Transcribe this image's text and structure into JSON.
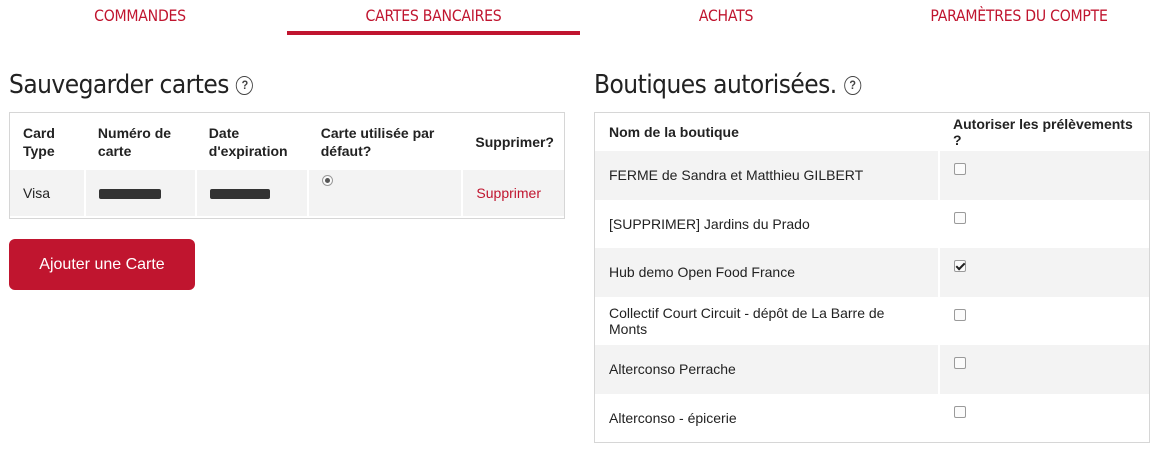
{
  "tabs": [
    {
      "label": "COMMANDES",
      "active": false
    },
    {
      "label": "CARTES BANCAIRES",
      "active": true
    },
    {
      "label": "ACHATS",
      "active": false
    },
    {
      "label": "PARAMÈTRES DU COMPTE",
      "active": false
    }
  ],
  "accent_color": "#c0152f",
  "saved_cards": {
    "title": "Sauvegarder cartes",
    "help_icon": "?",
    "headers": {
      "card_type": "Card Type",
      "card_number": "Numéro de carte",
      "expiry": "Date d'expiration",
      "default": "Carte utilisée par défaut?",
      "delete": "Supprimer?"
    },
    "rows": [
      {
        "type": "Visa",
        "number_masked": true,
        "expiry_masked": true,
        "is_default": true,
        "delete_label": "Supprimer"
      }
    ],
    "add_button": "Ajouter une Carte"
  },
  "shops": {
    "title": "Boutiques autorisées.",
    "help_icon": "?",
    "headers": {
      "name": "Nom de la boutique",
      "authorize": "Autoriser les prélèvements ?"
    },
    "rows": [
      {
        "name": "FERME de Sandra et Matthieu GILBERT",
        "authorized": false
      },
      {
        "name": "[SUPPRIMER] Jardins du Prado",
        "authorized": false
      },
      {
        "name": "Hub demo Open Food France",
        "authorized": true
      },
      {
        "name": "Collectif Court Circuit - dépôt de La Barre de Monts",
        "authorized": false
      },
      {
        "name": "Alterconso Perrache",
        "authorized": false
      },
      {
        "name": "Alterconso - épicerie",
        "authorized": false
      }
    ]
  }
}
